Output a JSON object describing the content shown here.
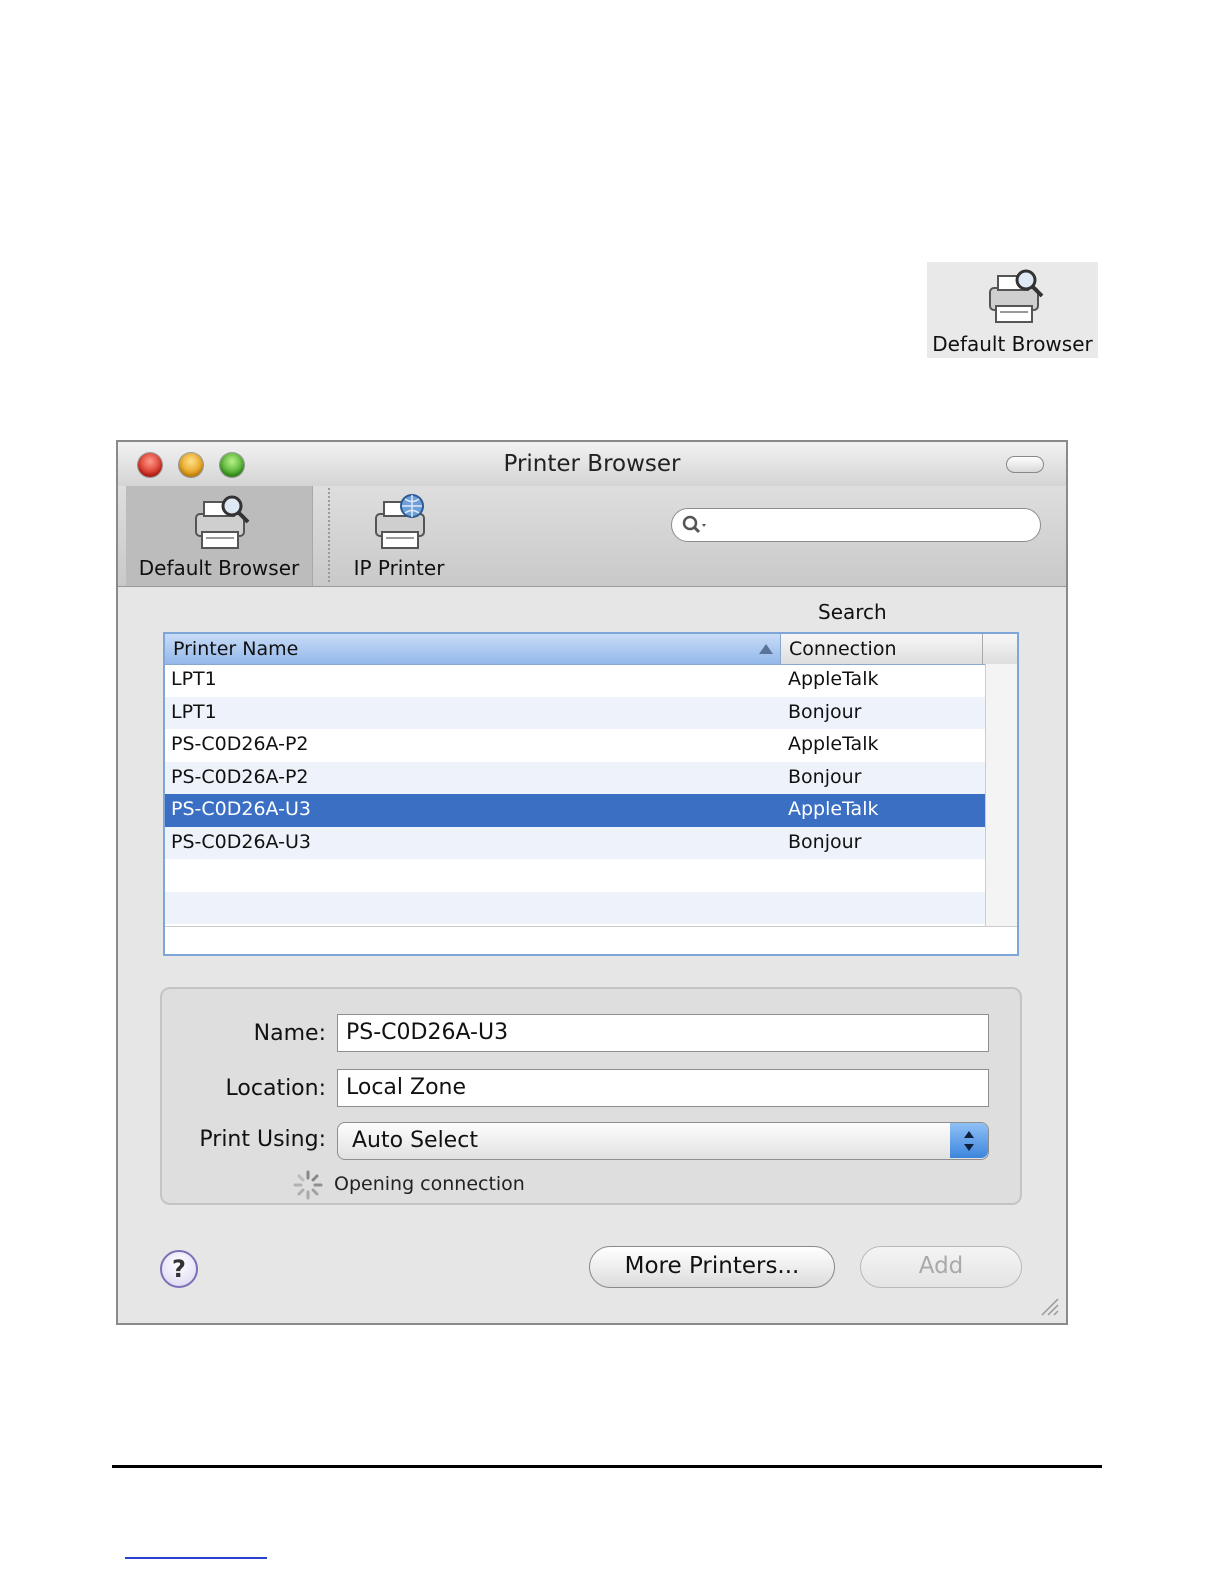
{
  "standalone_icon": {
    "label": "Default Browser",
    "icon": "printer-magnifier-icon"
  },
  "window": {
    "title": "Printer Browser",
    "toolbar": {
      "items": [
        {
          "label": "Default Browser",
          "icon": "printer-magnifier-icon",
          "selected": true
        },
        {
          "label": "IP Printer",
          "icon": "printer-globe-icon",
          "selected": false
        }
      ],
      "search": {
        "label": "Search",
        "value": "",
        "icon": "search-icon"
      }
    },
    "list": {
      "columns": [
        "Printer Name",
        "Connection"
      ],
      "rows": [
        {
          "name": "LPT1",
          "connection": "AppleTalk"
        },
        {
          "name": "LPT1",
          "connection": "Bonjour"
        },
        {
          "name": "PS-C0D26A-P2",
          "connection": "AppleTalk"
        },
        {
          "name": "PS-C0D26A-P2",
          "connection": "Bonjour"
        },
        {
          "name": "PS-C0D26A-U3",
          "connection": "AppleTalk"
        },
        {
          "name": "PS-C0D26A-U3",
          "connection": "Bonjour"
        }
      ],
      "selected_index": 4
    },
    "details": {
      "name_label": "Name:",
      "name_value": "PS-C0D26A-U3",
      "location_label": "Location:",
      "location_value": "Local Zone",
      "print_using_label": "Print Using:",
      "print_using_value": "Auto Select",
      "status": "Opening connection"
    },
    "buttons": {
      "help": "?",
      "more_printers": "More Printers...",
      "add": "Add"
    },
    "colors": {
      "selection": "#3a6fc4",
      "header_sorted": "#93b8ea"
    }
  }
}
